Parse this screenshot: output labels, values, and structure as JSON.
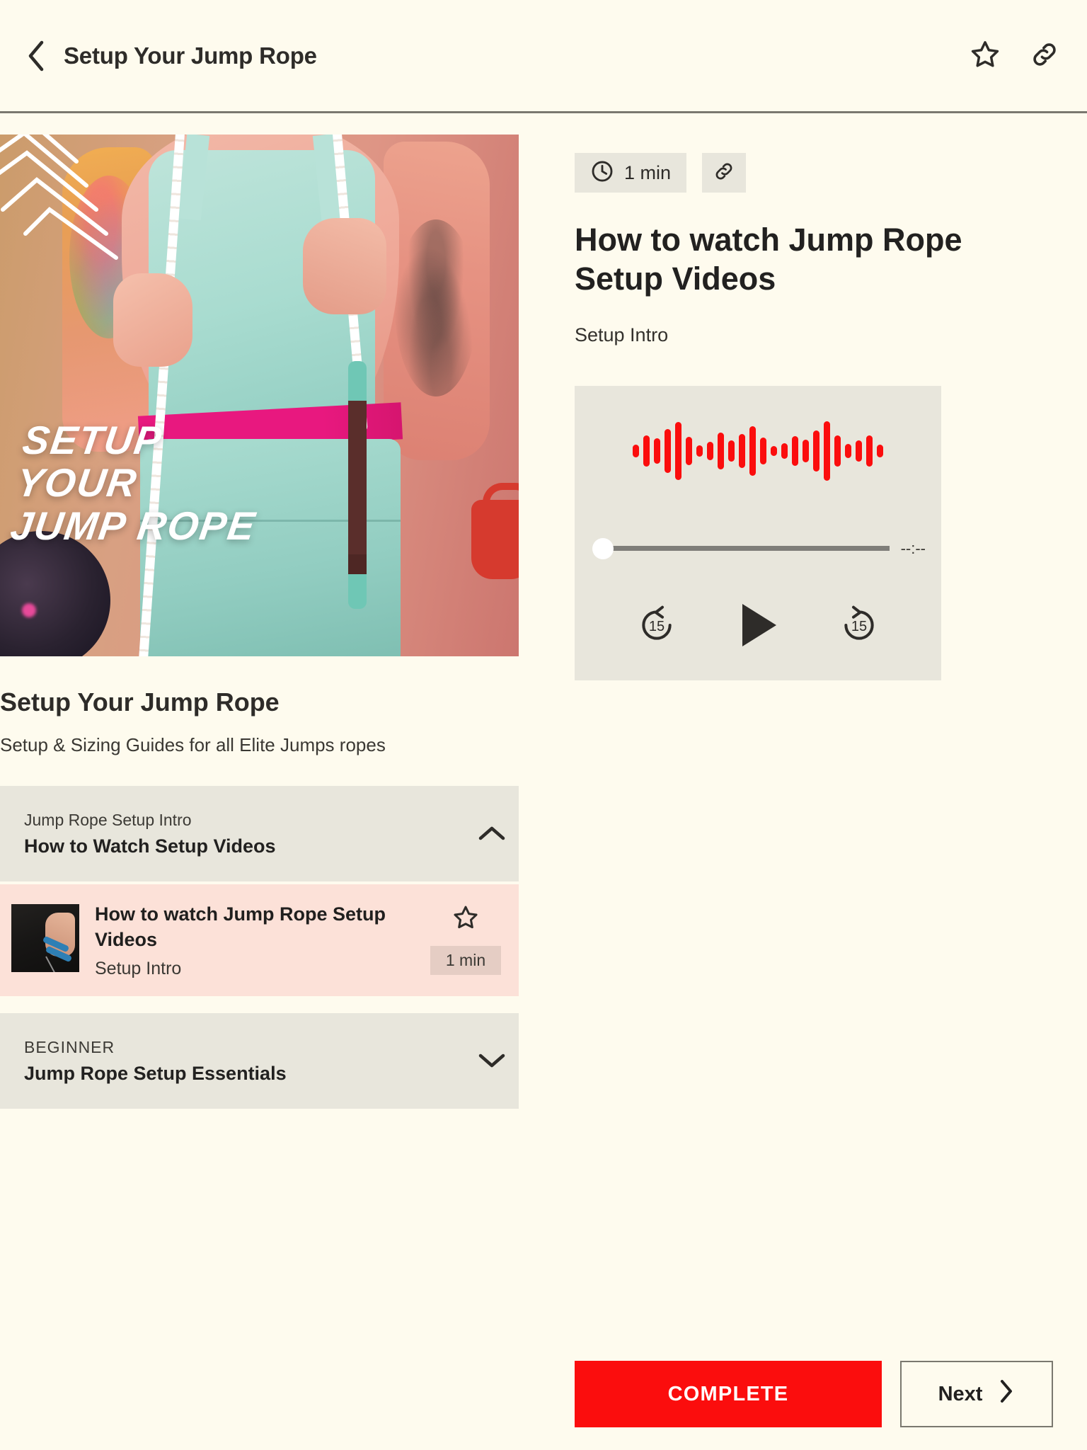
{
  "header": {
    "back_icon": "chevron-left-icon",
    "title": "Setup Your Jump Rope",
    "favorite_icon": "star-outline-icon",
    "share_icon": "link-icon"
  },
  "hero": {
    "overlay_line1": "SETUP",
    "overlay_line2": "YOUR",
    "overlay_line3": "JUMP ROPE",
    "alt": "Person in mint athletic wear holding a white jump rope"
  },
  "course": {
    "title": "Setup Your Jump Rope",
    "subtitle": "Setup & Sizing Guides for all Elite Jumps ropes"
  },
  "curriculum": {
    "sections": [
      {
        "kicker": "Jump Rope Setup Intro",
        "title": "How to Watch Setup Videos",
        "expanded": true,
        "chevron_icon": "chevron-up-icon"
      },
      {
        "kicker": "BEGINNER",
        "title": "Jump Rope Setup Essentials",
        "expanded": false,
        "chevron_icon": "chevron-down-icon"
      }
    ],
    "active_lesson": {
      "title": "How to watch Jump Rope Setup Videos",
      "subtitle": "Setup Intro",
      "duration": "1 min",
      "favorite_icon": "star-outline-icon",
      "thumbnail_alt": "Hand holding blue jump rope handles"
    }
  },
  "lesson_detail": {
    "duration_icon": "clock-icon",
    "duration": "1 min",
    "share_icon": "link-icon",
    "title": "How to watch Jump Rope Setup Videos",
    "subtitle": "Setup Intro"
  },
  "player": {
    "waveform_color": "#FB0D0D",
    "waveform_bars": [
      18,
      44,
      36,
      62,
      82,
      40,
      16,
      26,
      52,
      30,
      48,
      70,
      38,
      14,
      22,
      42,
      32,
      58,
      84,
      44,
      20,
      30,
      44,
      18
    ],
    "progress_percent": 0,
    "time_display": "--:--",
    "rewind_label": "15",
    "rewind_icon": "rewind-15-icon",
    "play_icon": "play-icon",
    "forward_label": "15",
    "forward_icon": "forward-15-icon"
  },
  "footer": {
    "complete_label": "COMPLETE",
    "next_label": "Next",
    "next_icon": "chevron-right-icon",
    "complete_color": "#FB0D0D"
  }
}
